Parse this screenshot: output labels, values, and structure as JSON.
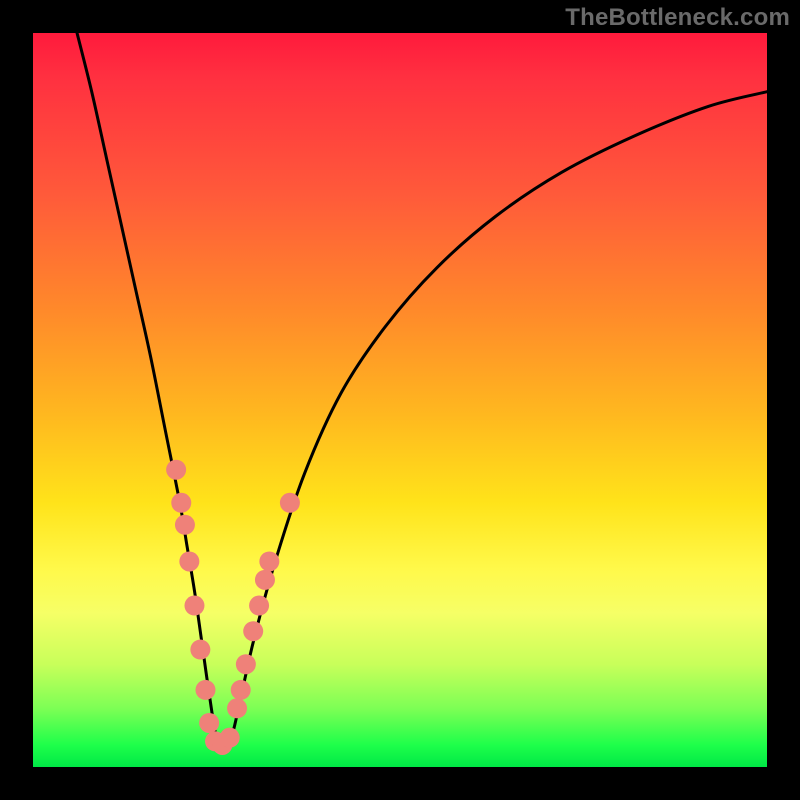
{
  "watermark": "TheBottleneck.com",
  "chart_data": {
    "type": "line",
    "title": "",
    "xlabel": "",
    "ylabel": "",
    "xlim": [
      0,
      100
    ],
    "ylim": [
      0,
      100
    ],
    "grid": false,
    "series": [
      {
        "name": "bottleneck-curve",
        "x_pct": [
          6,
          8,
          10,
          12,
          14,
          16,
          18,
          20,
          21,
          22,
          23,
          24,
          25,
          26,
          27,
          28,
          30,
          33,
          37,
          42,
          48,
          55,
          63,
          72,
          82,
          92,
          100
        ],
        "y_pct": [
          100,
          92,
          83,
          74,
          65,
          56,
          46,
          36,
          30,
          24,
          17,
          10,
          4,
          3,
          4,
          8,
          17,
          28,
          40,
          51,
          60,
          68,
          75,
          81,
          86,
          90,
          92
        ],
        "stroke": "#000000",
        "stroke_width_px": 3
      }
    ],
    "markers": [
      {
        "name": "scatter-points",
        "shape": "circle",
        "fill": "#ef8179",
        "radius_px": 10,
        "points_pct": [
          [
            19.5,
            40.5
          ],
          [
            20.2,
            36.0
          ],
          [
            20.7,
            33.0
          ],
          [
            21.3,
            28.0
          ],
          [
            22.0,
            22.0
          ],
          [
            22.8,
            16.0
          ],
          [
            23.5,
            10.5
          ],
          [
            24.0,
            6.0
          ],
          [
            24.8,
            3.5
          ],
          [
            25.8,
            3.0
          ],
          [
            26.8,
            4.0
          ],
          [
            27.8,
            8.0
          ],
          [
            28.3,
            10.5
          ],
          [
            29.0,
            14.0
          ],
          [
            30.0,
            18.5
          ],
          [
            30.8,
            22.0
          ],
          [
            31.6,
            25.5
          ],
          [
            32.2,
            28.0
          ],
          [
            35.0,
            36.0
          ]
        ]
      }
    ],
    "background_gradient": {
      "direction": "top-to-bottom",
      "stops": [
        {
          "pct": 0,
          "color": "#ff1a3c"
        },
        {
          "pct": 38,
          "color": "#ff8a2a"
        },
        {
          "pct": 64,
          "color": "#ffe31a"
        },
        {
          "pct": 86,
          "color": "#c8ff5a"
        },
        {
          "pct": 100,
          "color": "#00e846"
        }
      ]
    }
  }
}
